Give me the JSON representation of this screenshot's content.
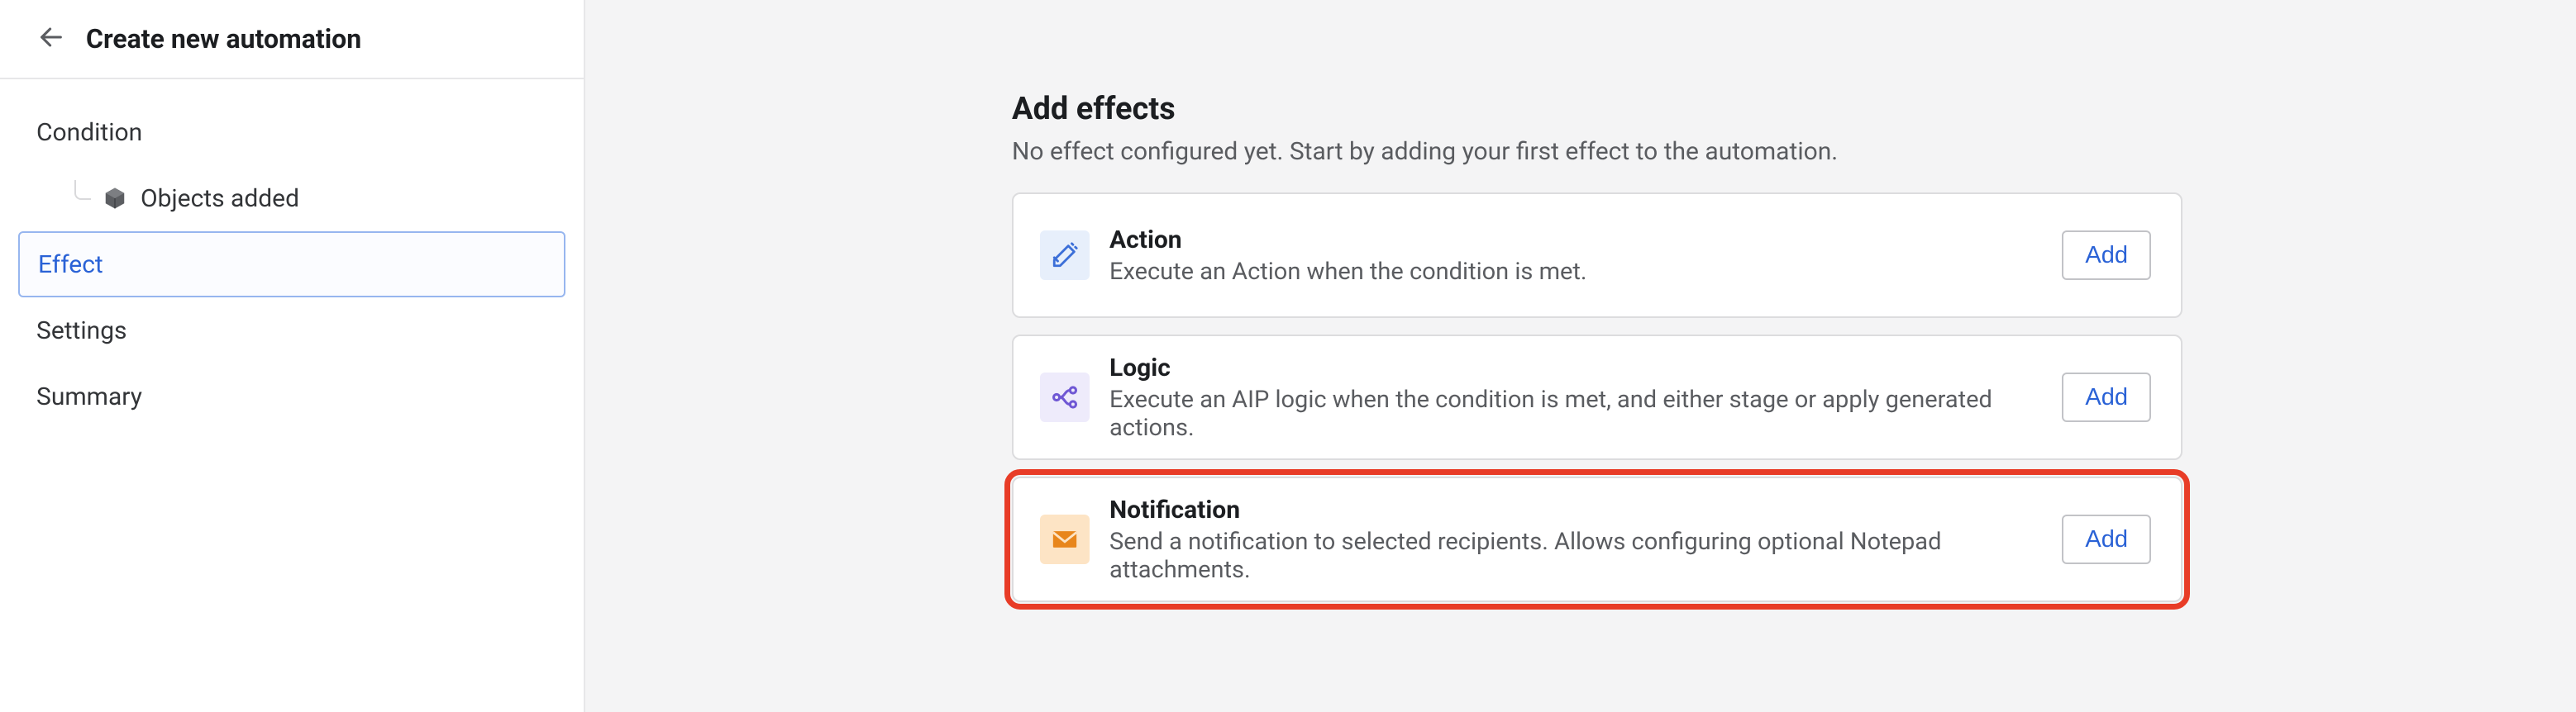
{
  "sidebar": {
    "title": "Create new automation",
    "nav": {
      "condition": "Condition",
      "condition_sub": "Objects added",
      "effect": "Effect",
      "settings": "Settings",
      "summary": "Summary"
    }
  },
  "main": {
    "title": "Add effects",
    "subtitle": "No effect configured yet. Start by adding your first effect to the automation.",
    "add_label": "Add",
    "effects": {
      "action": {
        "title": "Action",
        "desc": "Execute an Action when the condition is met."
      },
      "logic": {
        "title": "Logic",
        "desc": "Execute an AIP logic when the condition is met, and either stage or apply generated actions."
      },
      "notification": {
        "title": "Notification",
        "desc": "Send a notification to selected recipients. Allows configuring optional Notepad attachments."
      }
    }
  }
}
